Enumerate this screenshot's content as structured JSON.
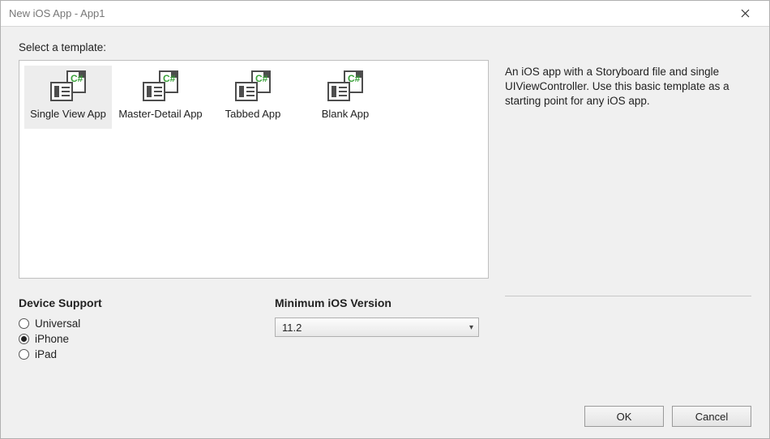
{
  "window": {
    "title": "New iOS App - App1"
  },
  "prompt": "Select a template:",
  "templates": {
    "items": [
      {
        "label": "Single View App",
        "selected": true
      },
      {
        "label": "Master-Detail App",
        "selected": false
      },
      {
        "label": "Tabbed App",
        "selected": false
      },
      {
        "label": "Blank App",
        "selected": false
      }
    ],
    "description": "An iOS app with a Storyboard file and single UIViewController. Use this basic template as a starting point for any iOS app."
  },
  "device_support": {
    "heading": "Device Support",
    "options": [
      {
        "label": "Universal",
        "checked": false
      },
      {
        "label": "iPhone",
        "checked": true
      },
      {
        "label": "iPad",
        "checked": false
      }
    ]
  },
  "min_ios": {
    "heading": "Minimum iOS Version",
    "selected": "11.2"
  },
  "buttons": {
    "ok": "OK",
    "cancel": "Cancel"
  }
}
